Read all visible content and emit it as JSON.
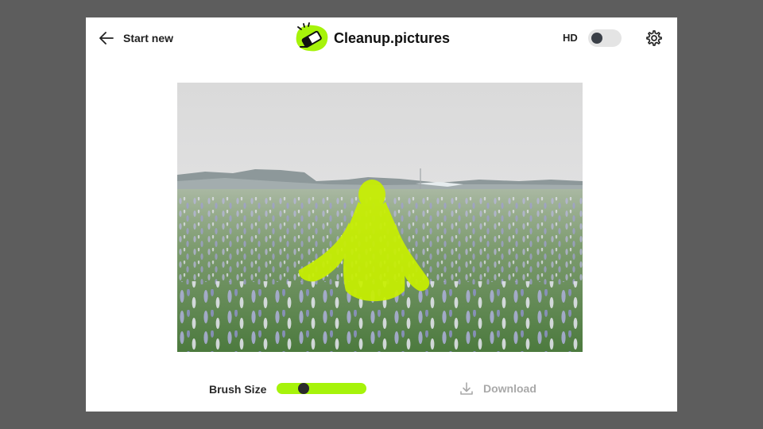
{
  "header": {
    "start_new_label": "Start new",
    "brand_name": "Cleanup.pictures",
    "hd_label": "HD",
    "hd_enabled": false
  },
  "footer": {
    "brush_size_label": "Brush Size",
    "brush_size_fraction": 0.27,
    "download_label": "Download",
    "download_enabled": false
  },
  "icons": {
    "back": "arrow-left-icon",
    "logo": "eraser-logo-icon",
    "settings": "gear-icon",
    "download": "download-icon"
  },
  "colors": {
    "accent": "#a6f30a",
    "mask": "#c8f000",
    "backdrop": "#5d5d5d",
    "disabled_text": "#a9a9a9"
  }
}
